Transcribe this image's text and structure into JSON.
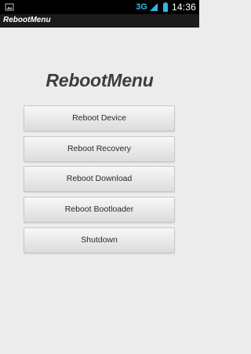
{
  "status_bar": {
    "network": "3G",
    "time": "14:36",
    "icons": [
      "notification-icon",
      "signal-icon",
      "battery-icon"
    ]
  },
  "action_bar": {
    "title": "RebootMenu"
  },
  "hero": {
    "title": "RebootMenu"
  },
  "buttons": [
    {
      "label": "Reboot Device"
    },
    {
      "label": "Reboot Recovery"
    },
    {
      "label": "Reboot Download"
    },
    {
      "label": "Reboot Bootloader"
    },
    {
      "label": "Shutdown"
    }
  ],
  "colors": {
    "status_bar": "#000000",
    "action_bar": "#1b1b1b",
    "background": "#ececec",
    "network_accent": "#33b5e5",
    "title_text": "#3d3d3d"
  }
}
